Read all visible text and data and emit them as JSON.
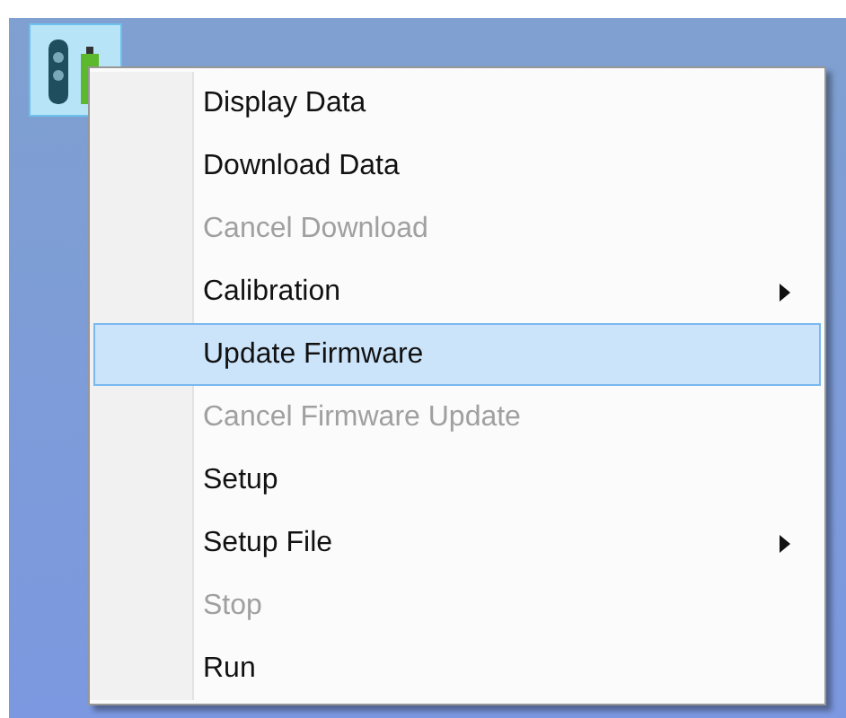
{
  "menu": {
    "items": [
      {
        "label": "Display Data",
        "disabled": false,
        "selected": false,
        "submenu": false
      },
      {
        "label": "Download Data",
        "disabled": false,
        "selected": false,
        "submenu": false
      },
      {
        "label": "Cancel Download",
        "disabled": true,
        "selected": false,
        "submenu": false
      },
      {
        "label": "Calibration",
        "disabled": false,
        "selected": false,
        "submenu": true
      },
      {
        "label": "Update Firmware",
        "disabled": false,
        "selected": true,
        "submenu": false
      },
      {
        "label": "Cancel Firmware Update",
        "disabled": true,
        "selected": false,
        "submenu": false
      },
      {
        "label": "Setup",
        "disabled": false,
        "selected": false,
        "submenu": false
      },
      {
        "label": "Setup File",
        "disabled": false,
        "selected": false,
        "submenu": true
      },
      {
        "label": "Stop",
        "disabled": true,
        "selected": false,
        "submenu": false
      },
      {
        "label": "Run",
        "disabled": false,
        "selected": false,
        "submenu": false
      }
    ]
  }
}
